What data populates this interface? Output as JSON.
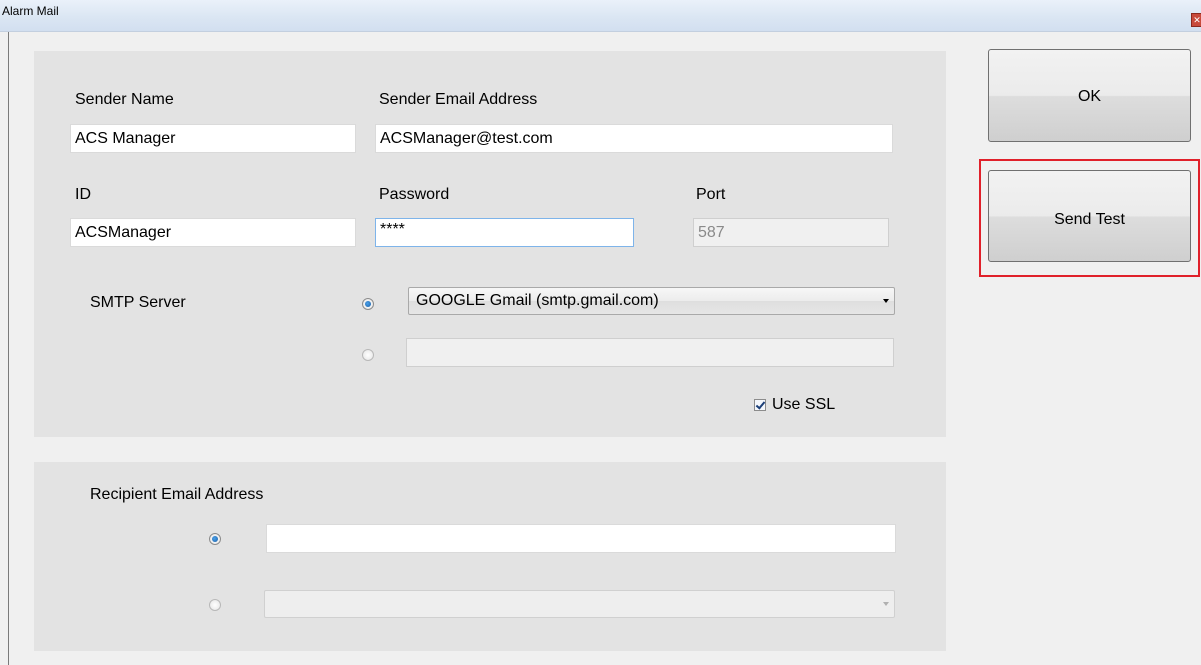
{
  "window": {
    "title": "Alarm Mail",
    "close_glyph": "✕"
  },
  "sender": {
    "name_label": "Sender Name",
    "name_value": "ACS Manager",
    "email_label": "Sender Email Address",
    "email_value": "ACSManager@test.com",
    "id_label": "ID",
    "id_value": "ACSManager",
    "password_label": "Password",
    "password_value": "****",
    "port_label": "Port",
    "port_value": "587"
  },
  "smtp": {
    "label": "SMTP Server",
    "preset_selected": true,
    "preset_value": "GOOGLE Gmail (smtp.gmail.com)",
    "custom_value": "",
    "ssl_label": "Use SSL",
    "ssl_checked": true
  },
  "recipient": {
    "label": "Recipient Email Address",
    "manual_selected": true,
    "manual_value": "",
    "list_value": ""
  },
  "buttons": {
    "ok": "OK",
    "send_test": "Send Test"
  },
  "colors": {
    "highlight": "#e0202a",
    "panel": "#e3e3e3",
    "background": "#f0f0f0"
  }
}
